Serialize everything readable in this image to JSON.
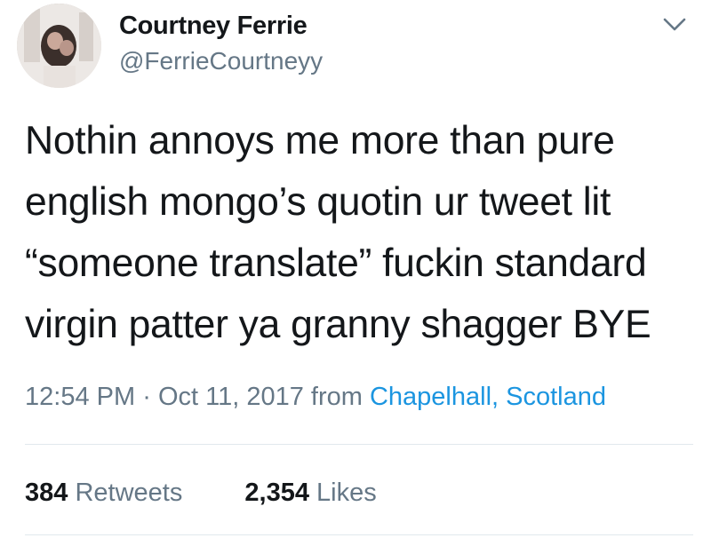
{
  "author": {
    "display_name": "Courtney Ferrie",
    "handle": "@FerrieCourtneyy"
  },
  "tweet": {
    "text": "Nothin annoys me more than pure\nenglish mongo’s quotin ur tweet lit\n“someone translate” fuckin standard\nvirgin patter ya granny shagger BYE",
    "time": "12:54 PM",
    "separator": "·",
    "date": "Oct 11, 2017",
    "from_label": "from",
    "location": "Chapelhall, Scotland"
  },
  "stats": {
    "retweets_count": "384",
    "retweets_label": "Retweets",
    "likes_count": "2,354",
    "likes_label": "Likes"
  },
  "colors": {
    "text": "#14171a",
    "secondary": "#657786",
    "link": "#1b95e0",
    "divider": "#e1e8ed"
  },
  "icons": {
    "menu": "chevron-down-icon"
  }
}
